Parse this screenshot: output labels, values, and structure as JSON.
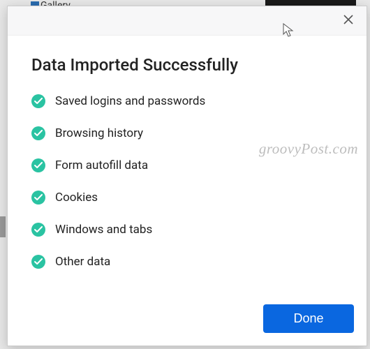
{
  "background": {
    "tab_fragment": "Gallery"
  },
  "dialog": {
    "title": "Data Imported Successfully",
    "items": [
      {
        "label": "Saved logins and passwords"
      },
      {
        "label": "Browsing history"
      },
      {
        "label": "Form autofill data"
      },
      {
        "label": "Cookies"
      },
      {
        "label": "Windows and tabs"
      },
      {
        "label": "Other data"
      }
    ],
    "done_label": "Done"
  },
  "watermark": "groovyPost.com"
}
